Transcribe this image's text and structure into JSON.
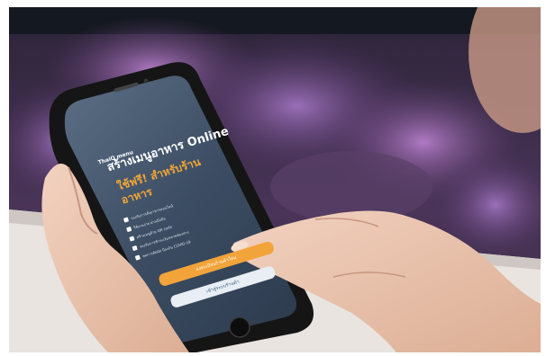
{
  "screen": {
    "brand": "ThaiQ menu",
    "headline": "สร้างเมนูอาหาร Online",
    "subhead_line1": "ใช้ฟรี! สำหรับร้าน",
    "subhead_line2": "อาหาร",
    "features": [
      "รองรับการสั่งอาหารออนไลน์",
      "ใช้งานง่าย ผ่านมือถือ",
      "สร้างเมนูด้วย QR code",
      "รองรับการชำระเงินหลายช่องทาง",
      "ลดการสัมผัส ป้องกัน COVID-19"
    ],
    "primary_button": "ลงทะเบียนร้านค้าใหม่",
    "secondary_button": "เข้าสู่ระบบร้านค้า"
  },
  "colors": {
    "accent_orange": "#f2a43a",
    "phone_body": "#151515",
    "background_coral": "#7b4f8e"
  }
}
